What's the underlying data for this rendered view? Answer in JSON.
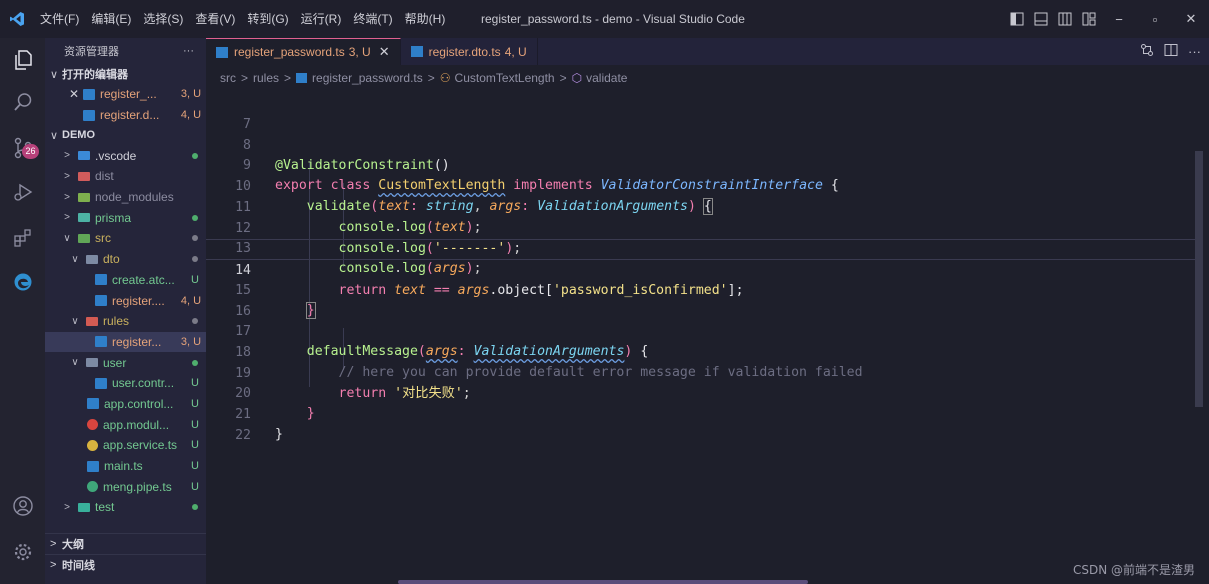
{
  "titlebar": {
    "menu": [
      "文件(F)",
      "编辑(E)",
      "选择(S)",
      "查看(V)",
      "转到(G)",
      "运行(R)",
      "终端(T)",
      "帮助(H)"
    ],
    "window_title": "register_password.ts - demo - Visual Studio Code",
    "window_controls": [
      "minimize-icon",
      "restore-icon",
      "close-icon"
    ],
    "minimize": "−",
    "restore": "▫",
    "close": "✕"
  },
  "activity": {
    "scm_badge": "26"
  },
  "sidebar": {
    "title": "资源管理器",
    "more": "···",
    "open_editors_title": "打开的编辑器",
    "open_editors": [
      {
        "name": "register_...",
        "status": "3, U"
      },
      {
        "name": "register.d...",
        "status": "4, U"
      }
    ],
    "project_title": "DEMO",
    "tree": [
      {
        "name": ".vscode",
        "status": "•"
      },
      {
        "name": "dist",
        "status": ""
      },
      {
        "name": "node_modules",
        "status": ""
      },
      {
        "name": "prisma",
        "status": "•"
      },
      {
        "name": "src",
        "status": "•"
      },
      {
        "name": "dto",
        "status": "•"
      },
      {
        "name": "create.atc...",
        "status": "U"
      },
      {
        "name": "register....",
        "status": "4, U"
      },
      {
        "name": "rules",
        "status": "•"
      },
      {
        "name": "register...",
        "status": "3, U"
      },
      {
        "name": "user",
        "status": "•"
      },
      {
        "name": "user.contr...",
        "status": "U"
      },
      {
        "name": "app.control...",
        "status": "U"
      },
      {
        "name": "app.modul...",
        "status": "U"
      },
      {
        "name": "app.service.ts",
        "status": "U"
      },
      {
        "name": "main.ts",
        "status": "U"
      },
      {
        "name": "meng.pipe.ts",
        "status": "U"
      },
      {
        "name": "test",
        "status": "•"
      }
    ],
    "outline": "大纲",
    "timeline": "时间线"
  },
  "tabs": [
    {
      "label": "register_password.ts",
      "status": "3, U",
      "close": "✕"
    },
    {
      "label": "register.dto.ts",
      "status": "4, U"
    }
  ],
  "breadcrumb": [
    "src",
    "rules",
    "register_password.ts",
    "CustomTextLength",
    "validate"
  ],
  "editor": {
    "line_numbers": [
      "7",
      "8",
      "9",
      "10",
      "11",
      "12",
      "13",
      "14",
      "15",
      "16",
      "17",
      "18",
      "19",
      "20",
      "21",
      "22"
    ],
    "active_line": "14",
    "l8_decorator": "@ValidatorConstraint",
    "l8_rest": "()",
    "l9_export": "export",
    "l9_class": "class",
    "l9_name": "CustomTextLength",
    "l9_implements": "implements",
    "l9_iface": "ValidatorConstraintInterface",
    "l9_brace": " {",
    "l10_fn": "validate",
    "l10_p1": "text",
    "l10_t1": "string",
    "l10_p2": "args",
    "l10_t2": "ValidationArguments",
    "l11_obj": "console",
    "l11_fn": "log",
    "l11_arg": "text",
    "l12_str": "'-------'",
    "l13_arg": "args",
    "l14_return": "return",
    "l14_text": "text",
    "l14_op": " == ",
    "l14_args": "args",
    "l14_prop": ".object[",
    "l14_str": "'password_isConfirmed'",
    "l14_end": "];",
    "l15": "}",
    "l17_fn": "defaultMessage",
    "l17_p": "args",
    "l17_t": "ValidationArguments",
    "l18_comment": "// here you can provide default error message if validation failed",
    "l19_return": "return",
    "l19_str": "'对比失败'",
    "l20": "}",
    "l21": "}"
  },
  "watermark": "CSDN @前端不是渣男"
}
